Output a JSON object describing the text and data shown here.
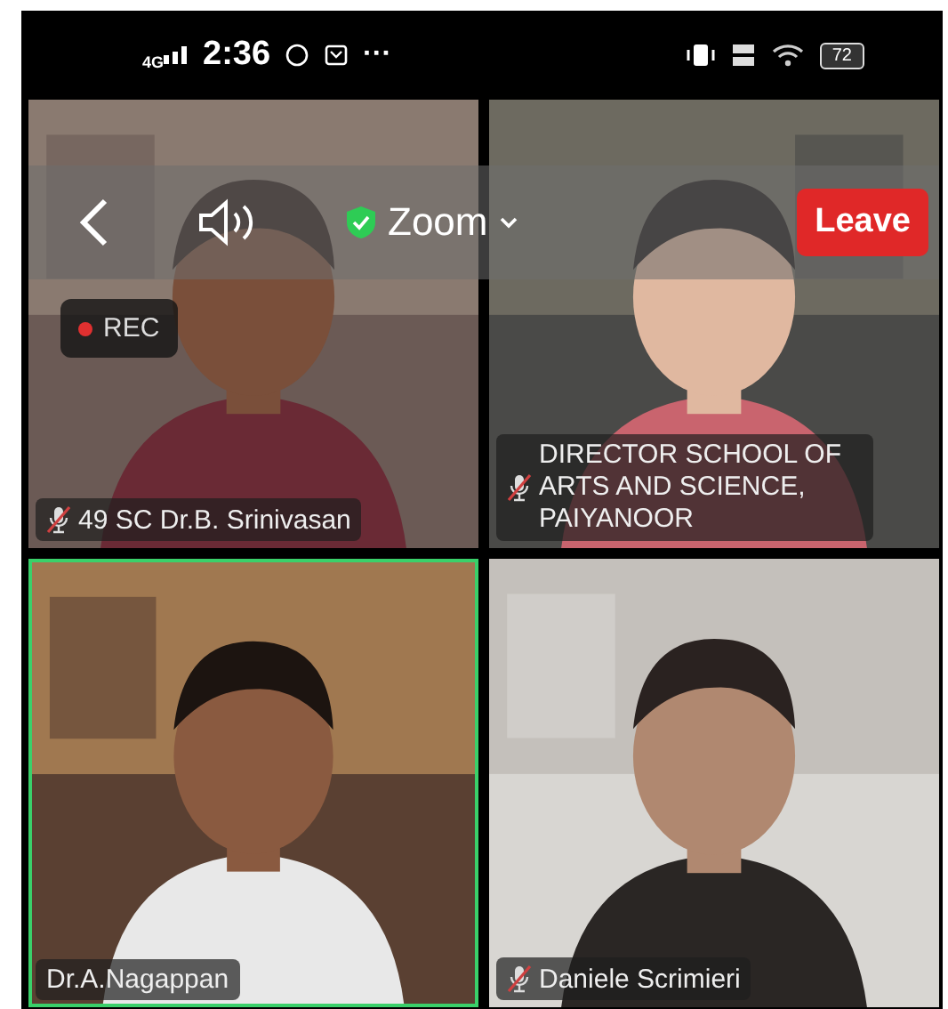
{
  "status_bar": {
    "network": "4G",
    "time": "2:36",
    "more": "···",
    "battery": "72"
  },
  "meeting_bar": {
    "title": "Zoom",
    "secure": true,
    "leave": "Leave"
  },
  "recording": {
    "label": "REC"
  },
  "participants": [
    {
      "name": "49 SC Dr.B. Srinivasan",
      "muted": true,
      "active_speaker": false,
      "kind": "picture"
    },
    {
      "name": "DIRECTOR SCHOOL OF ARTS AND SCIENCE, PAIYANOOR",
      "muted": true,
      "active_speaker": false,
      "kind": "picture"
    },
    {
      "name": "Dr.A.Nagappan",
      "muted": false,
      "active_speaker": true,
      "kind": "picture"
    },
    {
      "name": "Daniele Scrimieri",
      "muted": true,
      "active_speaker": false,
      "kind": "picture"
    }
  ]
}
